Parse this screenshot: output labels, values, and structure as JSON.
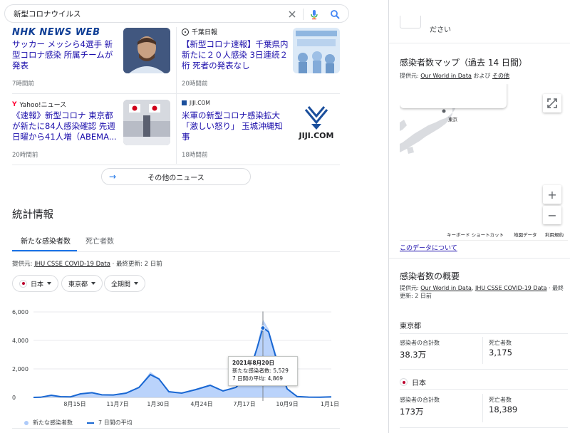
{
  "search": {
    "query": "新型コロナウイルス"
  },
  "news": [
    {
      "source": "NHK NEWS WEB",
      "title": "サッカー メッシら4選手 新型コロナ感染 所属チームが発表",
      "time": "7時間前"
    },
    {
      "source": "千葉日報",
      "title": "【新型コロナ速報】千葉県内新たに２０人感染 3日連続２桁 死者の発表なし",
      "time": "20時間前"
    },
    {
      "source": "Yahoo!ニュース",
      "title": "《速報》新型コロナ 東京都が新たに84人感染確認 先週日曜から41人増（ABEMA...",
      "time": "20時間前"
    },
    {
      "source": "JIJI.COM",
      "title": "米軍の新型コロナ感染拡大「激しい怒り」 玉城沖縄知事",
      "time": "18時間前",
      "thumb_text": "JIJI.COM"
    }
  ],
  "more_news": "その他のニュース",
  "stats": {
    "title": "統計情報",
    "tabs": [
      "新たな感染者数",
      "死亡者数"
    ],
    "source_prefix": "提供元: ",
    "source_link": "JHU CSSE COVID-19 Data",
    "updated": "· 最終更新: 2 日前",
    "filters": [
      "日本",
      "東京都",
      "全期間"
    ],
    "tooltip": {
      "date": "2021年8月20日",
      "new_cases": "新たな感染者数: 5,529",
      "avg": "7 日間の平均: 4,869"
    },
    "legend": [
      "新たな感染者数",
      "7 日間の平均"
    ]
  },
  "chart_data": {
    "type": "area",
    "x_ticks": [
      "8月15日",
      "11月7日",
      "1月30日",
      "4月24日",
      "7月17日",
      "10月9日",
      "1月1日"
    ],
    "y_ticks": [
      "0",
      "2,000",
      "4,000",
      "6,000"
    ],
    "ylim": [
      0,
      6000
    ],
    "series": [
      {
        "name": "新たな感染者数",
        "color": "#aecbfa"
      },
      {
        "name": "7 日間の平均",
        "color": "#1967d2"
      }
    ],
    "x": [
      "2020-02",
      "2020-03",
      "2020-04",
      "2020-05",
      "2020-06",
      "2020-07",
      "2020-08",
      "2020-09",
      "2020-10",
      "2020-11",
      "2020-12",
      "2021-01a",
      "2021-01b",
      "2021-02",
      "2021-03",
      "2021-04",
      "2021-05",
      "2021-06",
      "2021-07a",
      "2021-07b",
      "2021-08a",
      "2021-08b",
      "2021-08c",
      "2021-09a",
      "2021-09b",
      "2021-10",
      "2021-11",
      "2021-12",
      "2022-01"
    ],
    "avg_values": [
      0,
      10,
      150,
      50,
      40,
      250,
      330,
      180,
      170,
      300,
      700,
      1600,
      1300,
      400,
      300,
      550,
      850,
      450,
      700,
      1600,
      3500,
      4900,
      4600,
      2500,
      600,
      60,
      20,
      15,
      40
    ],
    "tooltip_point": {
      "date": "2021年8月20日",
      "new_cases": 5529,
      "avg": 4869
    }
  },
  "right_panel": {
    "top_text": "ださい",
    "map_title": "感染者数マップ（過去 14 日間）",
    "map_source_prefix": "提供元: ",
    "map_source_link": "Our World in Data",
    "map_source_mid": " および ",
    "map_source_link2": "その他",
    "map_city": "東京",
    "map_footer": [
      "キーボード ショートカット",
      "地図データ",
      "利用規約"
    ],
    "data_about": "このデータについて",
    "overview_title": "感染者数の概要",
    "overview_source_prefix": "提供元: ",
    "overview_source_link": "Our World in Data",
    "overview_source_sep": ", ",
    "overview_source_link2": "JHU CSSE COVID-19 Data",
    "overview_source_suffix": " · 最終",
    "overview_updated": "更新: 2 日前",
    "regions": [
      {
        "name": "東京都",
        "total_label": "感染者の合計数",
        "total": "38.3万",
        "deaths_label": "死亡者数",
        "deaths": "3,175"
      },
      {
        "name": "日本",
        "total_label": "感染者の合計数",
        "total": "173万",
        "deaths_label": "死亡者数",
        "deaths": "18,389"
      }
    ]
  }
}
